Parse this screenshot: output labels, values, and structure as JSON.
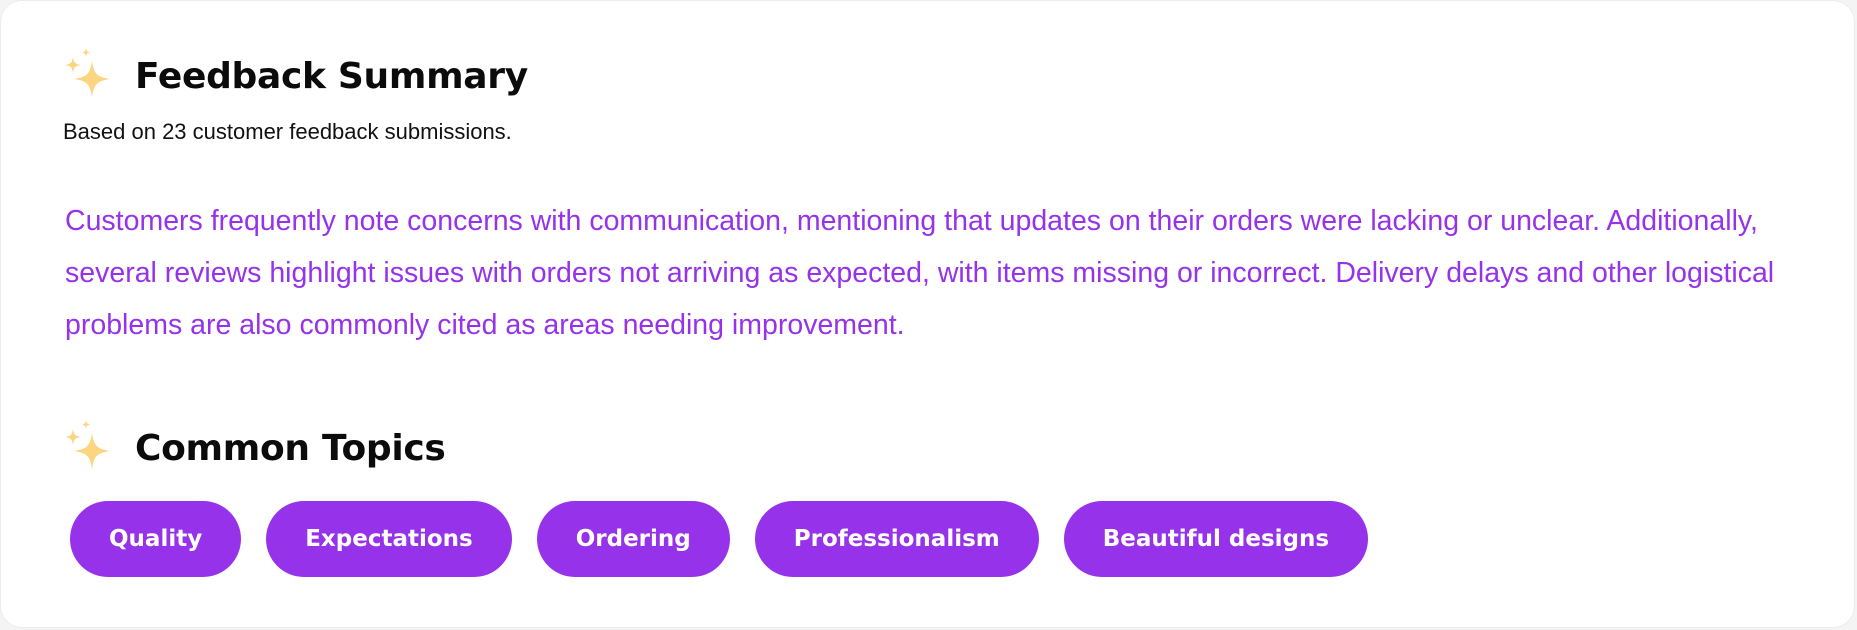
{
  "colors": {
    "accent": "#9633ea",
    "sparkle": "#fcd581",
    "heading": "#0b0b0b",
    "background": "#ffffff"
  },
  "summary": {
    "icon": "sparkles-icon",
    "title": "Feedback Summary",
    "subtitle": "Based on 23 customer feedback submissions.",
    "text": "Customers frequently note concerns with communication, mentioning that updates on their orders were lacking or unclear. Additionally, several reviews highlight issues with orders not arriving as expected, with items missing or incorrect. Delivery delays and other logistical problems are also commonly cited as areas needing improvement."
  },
  "topics": {
    "icon": "sparkles-icon",
    "title": "Common Topics",
    "items": [
      {
        "label": "Quality"
      },
      {
        "label": "Expectations"
      },
      {
        "label": "Ordering"
      },
      {
        "label": "Professionalism"
      },
      {
        "label": "Beautiful designs"
      }
    ]
  }
}
